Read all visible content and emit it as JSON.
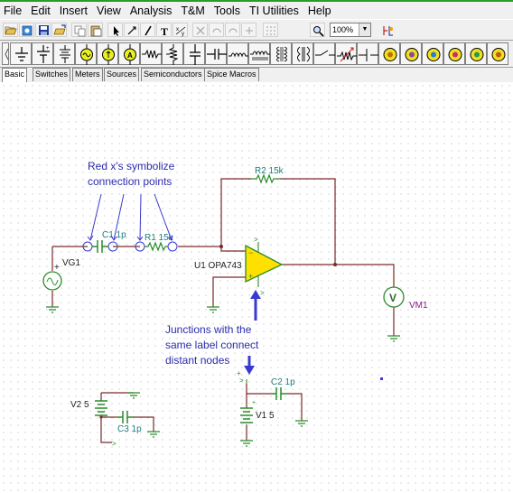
{
  "menubar": {
    "items": [
      "File",
      "Edit",
      "Insert",
      "View",
      "Analysis",
      "T&M",
      "Tools",
      "TI Utilities",
      "Help"
    ]
  },
  "toolbar": {
    "zoom_value": "100%",
    "tools": [
      "open-icon",
      "new-icon",
      "save-icon",
      "folder-icon",
      "copy-icon",
      "paste-icon",
      "select-arrow-icon",
      "wire-icon",
      "pencil-icon",
      "text-icon",
      "fraction-icon",
      "delete-icon",
      "undo-icon",
      "redo-icon",
      "plus-icon",
      "grid-icon",
      "zoom-icon",
      "probe-icon"
    ]
  },
  "palette": {
    "components": [
      "ground-icon",
      "battery-icon",
      "voltage-source-icon",
      "current-source-icon",
      "ammeter-icon",
      "resistor-icon",
      "switch-icon",
      "capacitor-icon",
      "inductor-icon",
      "transformer-icon",
      "diode-icon",
      "pot-icon",
      "relay-icon",
      "meter-icon"
    ]
  },
  "tabs": [
    "Basic",
    "Switches",
    "Meters",
    "Sources",
    "Semiconductors",
    "Spice Macros"
  ],
  "schematic": {
    "annotation_top_line1": "Red x's symbolize",
    "annotation_top_line2": "connection points",
    "annotation_bottom_line1": "Junctions with the",
    "annotation_bottom_line2": "same label connect",
    "annotation_bottom_line3": "distant nodes",
    "r2_label": "R2 15k",
    "c1_label": "C1 1p",
    "r1_label": "R1 15k",
    "vg1_label": "VG1",
    "u1_label": "U1 OPA743",
    "vm1_label": "VM1",
    "c2_label": "C2 1p",
    "v2_label": "V2 5",
    "v1_label": "V1 5",
    "c3_label": "C3 1p",
    "colors": {
      "wire": "#7a2a2a",
      "component": "#2a8c2a",
      "annotation": "#2c2cae",
      "opamp_fill": "#ffe000",
      "marker": "#3a3ad0"
    }
  }
}
